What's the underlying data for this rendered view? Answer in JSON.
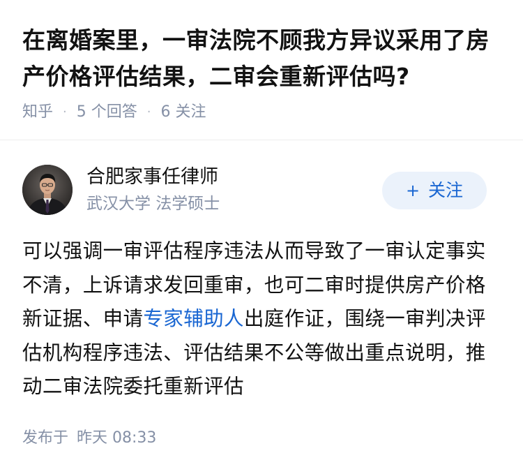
{
  "question": {
    "title": "在离婚案里，一审法院不顾我方异议采用了房产价格评估结果，二审会重新评估吗?",
    "source": "知乎",
    "separator": "·",
    "answers_count": "5 个回答",
    "followers_count": "6 关注"
  },
  "author": {
    "name": "合肥家事任律师",
    "headline": "武汉大学 法学硕士",
    "follow_plus": "+",
    "follow_label": "关注"
  },
  "answer": {
    "text_before_link": "可以强调一审评估程序违法从而导致了一审认定事实不清，上诉请求发回重审，也可二审时提供房产价格新证据、申请",
    "link_text": "专家辅助人",
    "text_after_link": "出庭作证，围绕一审判决评估机构程序违法、评估结果不公等做出重点说明，推动二审法院委托重新评估"
  },
  "footer": {
    "published_label": "发布于",
    "published_time": "昨天 08:33"
  },
  "colors": {
    "link": "#1966d2",
    "meta_gray": "#8590a6",
    "follow_bg": "#ebf2fb"
  }
}
